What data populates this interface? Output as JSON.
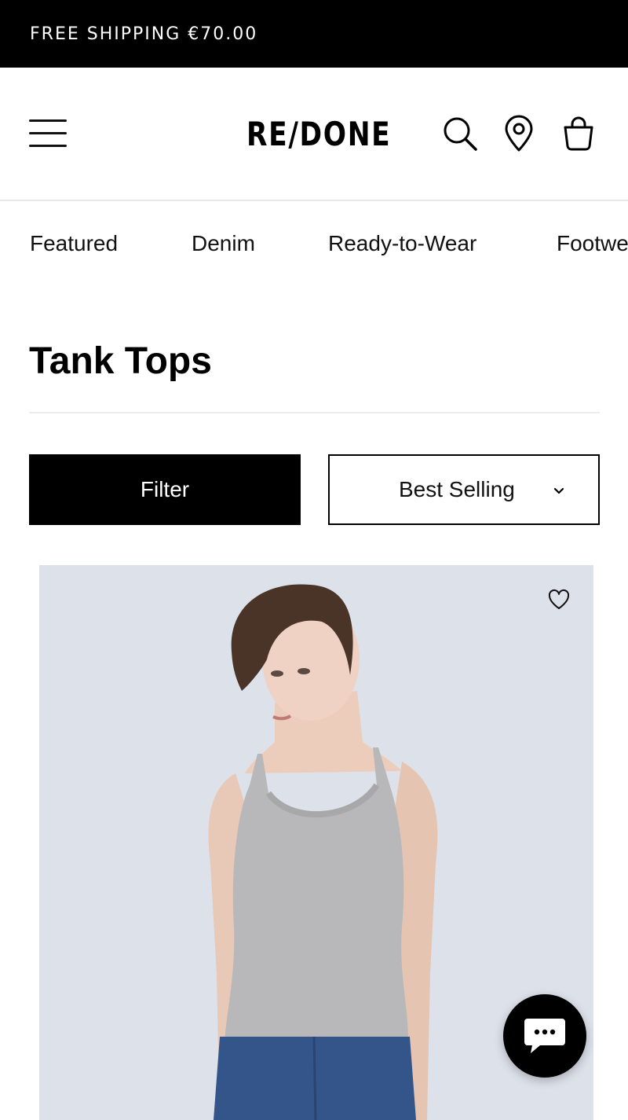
{
  "promo": {
    "text": "FREE SHIPPING €70.00"
  },
  "header": {
    "logo": "RE/DONE",
    "icons": [
      "menu-icon",
      "search-icon",
      "location-pin-icon",
      "shopping-bag-icon"
    ]
  },
  "nav": {
    "items": [
      {
        "label": "Featured"
      },
      {
        "label": "Denim"
      },
      {
        "label": "Ready-to-Wear"
      },
      {
        "label": "Footwear"
      }
    ]
  },
  "page": {
    "title": "Tank Tops"
  },
  "controls": {
    "filter_label": "Filter",
    "sort_selected": "Best Selling"
  },
  "product": {
    "icons": [
      "heart-icon"
    ]
  },
  "chat": {
    "icon": "chat-bubble-icon"
  },
  "colors": {
    "promo_bg": "#000000",
    "image_bg": "#dde1ea",
    "accent": "#000000"
  }
}
